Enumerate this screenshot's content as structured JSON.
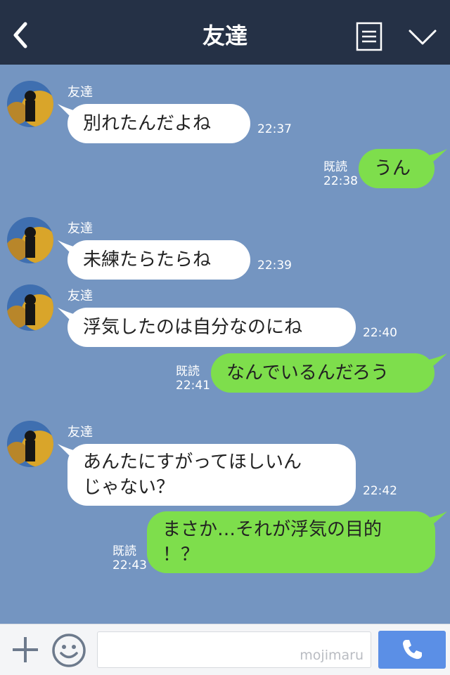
{
  "header": {
    "title": "友達",
    "back_icon": "chevron-left-icon",
    "menu_icon": "notes-icon",
    "expand_icon": "chevron-down-icon",
    "background": "#253146"
  },
  "chat": {
    "background": "#7495c1",
    "sender_name": "友達",
    "messages": [
      {
        "text": "別れたんだよね",
        "time": "22:37"
      },
      {
        "text": "うん",
        "time": "22:38",
        "read": "既読"
      },
      {
        "text": "未練たらたらね",
        "time": "22:39"
      },
      {
        "text": "浮気したのは自分なのにね",
        "time": "22:40"
      },
      {
        "text": "なんでいるんだろう",
        "time": "22:41",
        "read": "既読"
      },
      {
        "text_lines": [
          "あんたにすがってほしいん",
          "じゃない？"
        ],
        "time": "22:42"
      },
      {
        "text_lines": [
          "まさか…それが浮気の目的",
          "！？"
        ],
        "time": "22:43",
        "read": "既読"
      }
    ]
  },
  "footer": {
    "plus_icon": "plus-icon",
    "emoji_icon": "smiley-icon",
    "input_value": "",
    "watermark": "mojimaru",
    "call_icon": "phone-icon",
    "call_color": "#5b8fe6"
  },
  "colors": {
    "incoming_bubble": "#ffffff",
    "outgoing_bubble": "#7ede4c"
  }
}
